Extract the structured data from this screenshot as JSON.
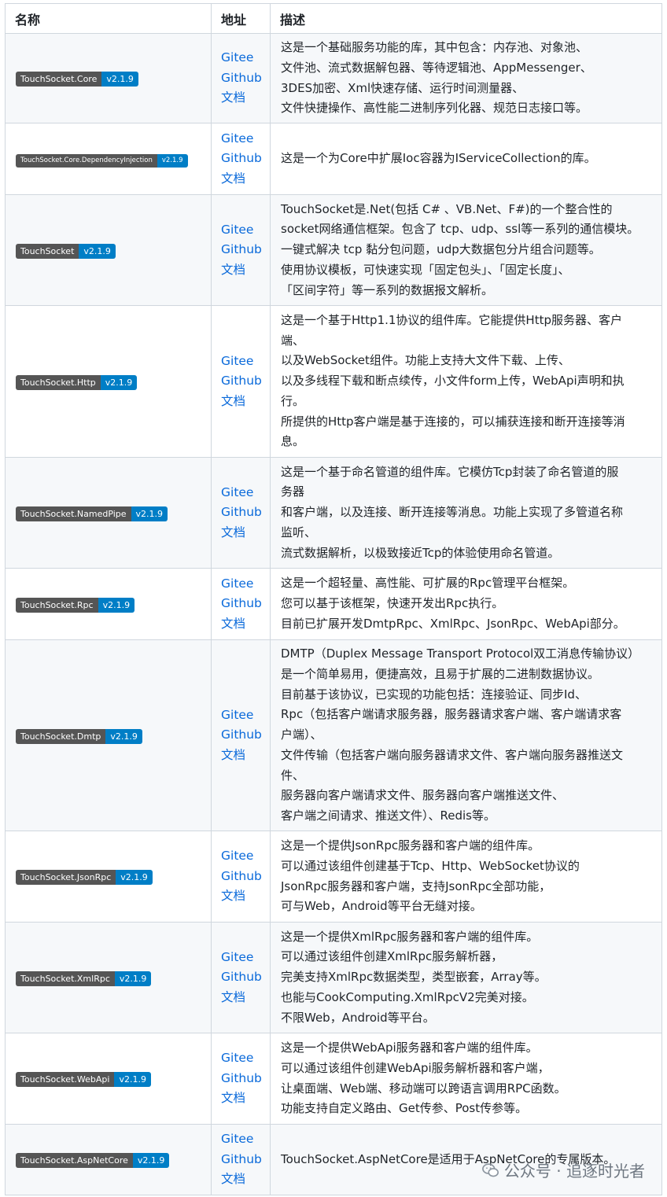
{
  "headers": {
    "name": "名称",
    "address": "地址",
    "description": "描述"
  },
  "link_labels": {
    "gitee": "Gitee",
    "github": "Github",
    "docs": "文档"
  },
  "badge_colors": {
    "name_bg": "#555555",
    "version_bg": "#007ec6"
  },
  "rows": [
    {
      "name": "TouchSocket.Core",
      "version": "v2.1.9",
      "desc": [
        "这是一个基础服务功能的库，其中包含：内存池、对象池、",
        "文件池、流式数据解包器、等待逻辑池、AppMessenger、",
        "3DES加密、Xml快速存储、运行时间测量器、",
        "文件快捷操作、高性能二进制序列化器、规范日志接口等。"
      ]
    },
    {
      "name": "TouchSocket.Core.DependencyInjection",
      "version": "v2.1.9",
      "desc": [
        "这是一个为Core中扩展Ioc容器为IServiceCollection的库。"
      ]
    },
    {
      "name": "TouchSocket",
      "version": "v2.1.9",
      "desc": [
        "TouchSocket是.Net(包括 C# 、VB.Net、F#)的一个整合性的",
        "socket网络通信框架。包含了 tcp、udp、ssl等一系列的通信模块。",
        "一键式解决 tcp 黏分包问题，udp大数据包分片组合问题等。",
        "使用协议模板，可快速实现「固定包头」、「固定长度」、",
        "「区间字符」等一系列的数据报文解析。"
      ]
    },
    {
      "name": "TouchSocket.Http",
      "version": "v2.1.9",
      "desc": [
        "这是一个基于Http1.1协议的组件库。它能提供Http服务器、客户",
        "端、",
        "以及WebSocket组件。功能上支持大文件下载、上传、",
        "以及多线程下载和断点续传，小文件form上传，WebApi声明和执",
        "行。",
        "所提供的Http客户端是基于连接的，可以捕获连接和断开连接等消",
        "息。"
      ]
    },
    {
      "name": "TouchSocket.NamedPipe",
      "version": "v2.1.9",
      "desc": [
        "这是一个基于命名管道的组件库。它模仿Tcp封装了命名管道的服",
        "务器",
        "和客户端，以及连接、断开连接等消息。功能上实现了多管道名称",
        "监听、",
        "流式数据解析，以极致接近Tcp的体验使用命名管道。"
      ]
    },
    {
      "name": "TouchSocket.Rpc",
      "version": "v2.1.9",
      "desc": [
        "这是一个超轻量、高性能、可扩展的Rpc管理平台框架。",
        "您可以基于该框架，快速开发出Rpc执行。",
        "目前已扩展开发DmtpRpc、XmlRpc、JsonRpc、WebApi部分。"
      ]
    },
    {
      "name": "TouchSocket.Dmtp",
      "version": "v2.1.9",
      "desc": [
        "DMTP（Duplex Message Transport Protocol双工消息传输协议）",
        "是一个简单易用，便捷高效，且易于扩展的二进制数据协议。",
        "目前基于该协议，已实现的功能包括：连接验证、同步Id、",
        "Rpc（包括客户端请求服务器，服务器请求客户端、客户端请求客",
        "户端）、",
        "文件传输（包括客户端向服务器请求文件、客户端向服务器推送文",
        "件、",
        "服务器向客户端请求文件、服务器向客户端推送文件、",
        "客户端之间请求、推送文件）、Redis等。"
      ]
    },
    {
      "name": "TouchSocket.JsonRpc",
      "version": "v2.1.9",
      "desc": [
        "这是一个提供JsonRpc服务器和客户端的组件库。",
        "可以通过该组件创建基于Tcp、Http、WebSocket协议的",
        "JsonRpc服务器和客户端，支持JsonRpc全部功能，",
        "可与Web，Android等平台无缝对接。"
      ]
    },
    {
      "name": "TouchSocket.XmlRpc",
      "version": "v2.1.9",
      "desc": [
        "这是一个提供XmlRpc服务器和客户端的组件库。",
        "可以通过该组件创建XmlRpc服务解析器，",
        "完美支持XmlRpc数据类型，类型嵌套，Array等。",
        "也能与CookComputing.XmlRpcV2完美对接。",
        "不限Web，Android等平台。"
      ]
    },
    {
      "name": "TouchSocket.WebApi",
      "version": "v2.1.9",
      "desc": [
        "这是一个提供WebApi服务器和客户端的组件库。",
        "可以通过该组件创建WebApi服务解析器和客户端，",
        "让桌面端、Web端、移动端可以跨语言调用RPC函数。",
        "功能支持自定义路由、Get传参、Post传参等。"
      ]
    },
    {
      "name": "TouchSocket.AspNetCore",
      "version": "v2.1.9",
      "desc": [
        "TouchSocket.AspNetCore是适用于AspNetCore的专属版本。"
      ]
    }
  ],
  "watermark": {
    "text": "公众号 · 追逐时光者",
    "icon": "wechat-icon"
  }
}
